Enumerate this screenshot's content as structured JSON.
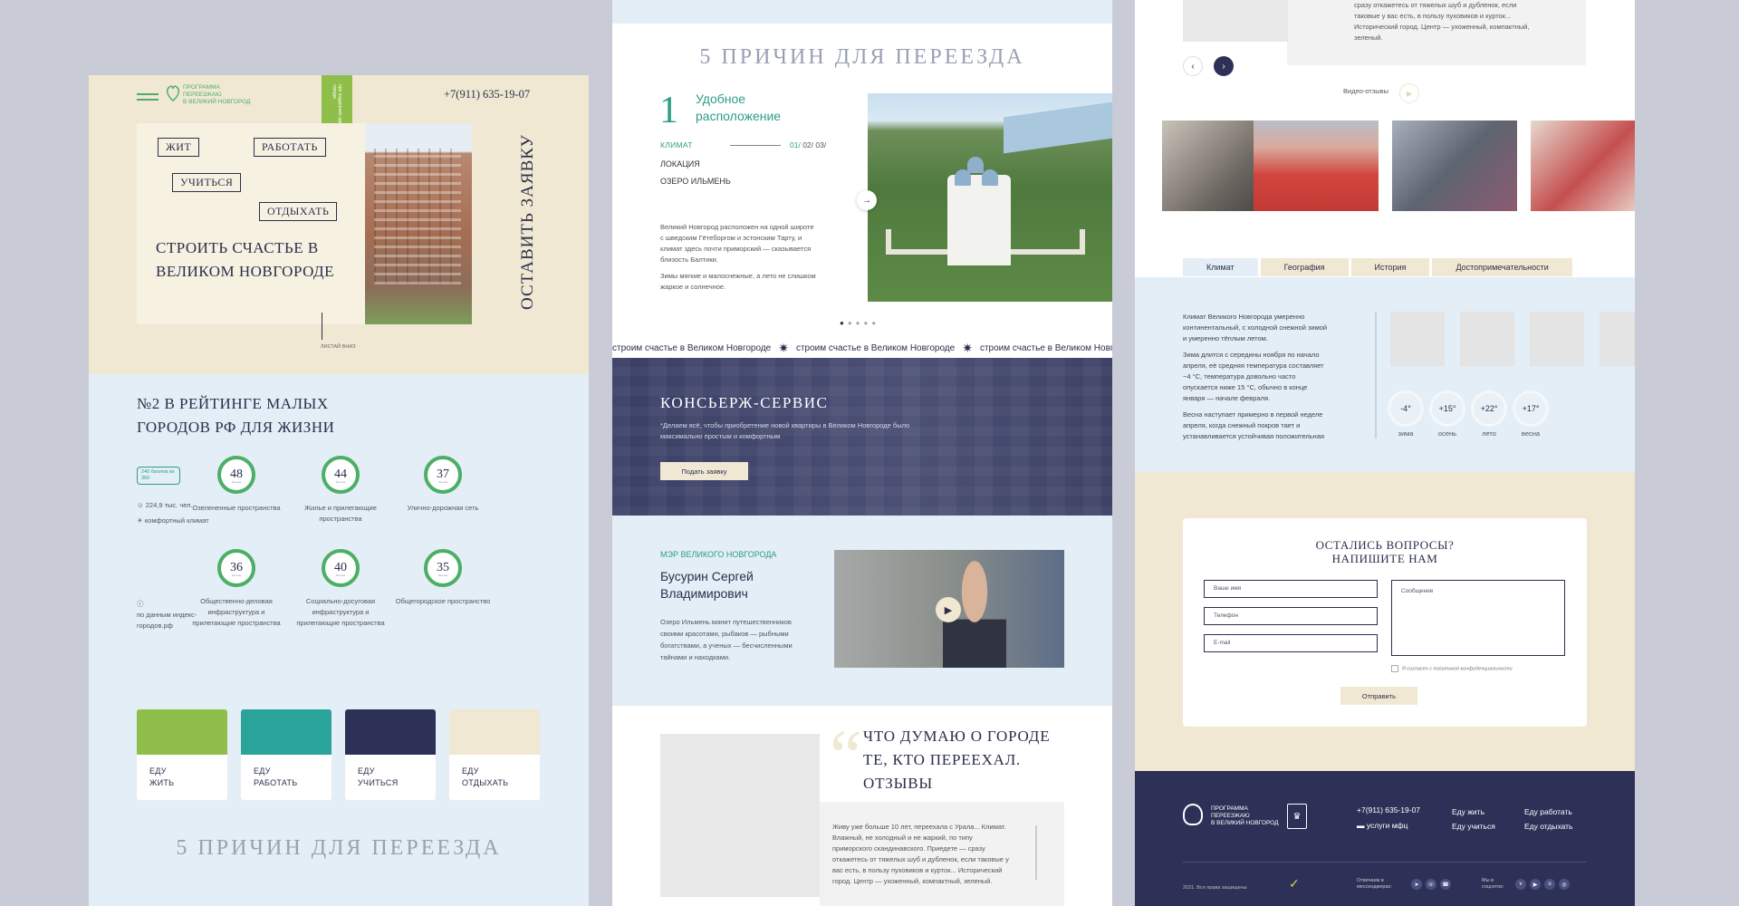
{
  "panel1": {
    "logo": {
      "line1": "ПРОГРАММА",
      "line2": "ПЕРЕЕЗЖАЮ",
      "line3": "В ВЕЛИКИЙ НОВГОРОД"
    },
    "phone": "+7(911) 635-19-07",
    "ribbon": "при поддержке администрации города",
    "tags": [
      "ЖИТ",
      "РАБОТАТЬ",
      "УЧИТЬСЯ",
      "ОТДЫХАТЬ"
    ],
    "hero_title": "СТРОИТЬ СЧАСТЬЕ В ВЕЛИКОМ НОВГОРОДЕ",
    "vertical_cta": "ОСТАВИТЬ ЗАЯВКУ",
    "scroll_label": "ЛИСТАЙ ВНИЗ",
    "rating_title": "№2 В РЕЙТИНГЕ МАЛЫХ ГОРОДОВ РФ ДЛЯ ЖИЗНИ",
    "badge": "240 баллов из 360",
    "stat_population": "224,9 тыс. чел.",
    "stat_climate": "комфортный климат",
    "source": "по данным индекс-городов.рф",
    "rings": [
      {
        "value": "48",
        "label": "Озелененные пространства"
      },
      {
        "value": "44",
        "label": "Жилье и прилегающие пространства"
      },
      {
        "value": "37",
        "label": "Улично-дорожная сеть"
      },
      {
        "value": "36",
        "label": "Общественно-деловая инфраструктура и прилегающие пространства"
      },
      {
        "value": "40",
        "label": "Социально-досуговая инфраструктура и прилегающие пространства"
      },
      {
        "value": "35",
        "label": "Общегородское пространство"
      }
    ],
    "ring_unit": "баллов",
    "cards": [
      {
        "line1": "ЕДУ",
        "line2": "ЖИТЬ",
        "color": "#8fbf4a"
      },
      {
        "line1": "ЕДУ",
        "line2": "РАБОТАТЬ",
        "color": "#2aa39b"
      },
      {
        "line1": "ЕДУ",
        "line2": "УЧИТЬСЯ",
        "color": "#2d3157"
      },
      {
        "line1": "ЕДУ",
        "line2": "ОТДЫХАТЬ",
        "color": "#f1e8d3"
      }
    ],
    "reasons_title": "5 ПРИЧИН ДЛЯ ПЕРЕЕЗДА"
  },
  "panel2": {
    "reasons_title": "5 ПРИЧИН ДЛЯ ПЕРЕЕЗДА",
    "reason_number": "1",
    "reason_heading1": "Удобное",
    "reason_heading2": "расположение",
    "klimat": "КЛИМАТ",
    "pages": {
      "current": "01/",
      "p2": "02/",
      "p3": "03/"
    },
    "items": [
      "ЛОКАЦИЯ",
      "ОЗЕРО ИЛЬМЕНЬ"
    ],
    "desc1": "Великий Новгород расположен на одной широте с шведским Гётеборгом и эстонским Тарту, и климат здесь почти приморский — сказывается близость Балтики.",
    "desc2": "Зимы мягкие и малоснежные, а лето не слишком жаркое и солнечное.",
    "marquee": "строим счастье в Великом Новгороде",
    "concierge_title": "КОНСЬЕРЖ-СЕРВИС",
    "concierge_text": "*Делаем всё, чтобы приобретение новой квартиры в Великом Новгороде было максимально простым и комфортным",
    "concierge_button": "Подать заявку",
    "mayor_role": "МЭР ВЕЛИКОГО НОВГОРОДА",
    "mayor_name1": "Бусурин Сергей",
    "mayor_name2": "Владимирович",
    "mayor_text": "Озеро Ильмень манит путешественников своими красотами, рыбаков — рыбными богатствами, а ученых — бесчисленными тайнами и находками.",
    "reviews_title": "ЧТО ДУМАЮ О ГОРОДЕ ТЕ, КТО ПЕРЕЕХАЛ. ОТЗЫВЫ",
    "review_text": "Живу уже больше 10 лет, переехала с Урала... Климат. Влажный, не холодный и не жаркий, по типу приморского скандинавского. Приедете — сразу откажетесь от тяжелых шуб и дубленок, если таковые у вас есть, в пользу пуховиков и курток... Исторический город. Центр — ухоженный, компактный, зеленый."
  },
  "panel3": {
    "top_text": "сразу откажетесь от тяжелых шуб и дубленок, если таковые у вас есть, в пользу пуховиков и курток... Исторический город. Центр — ухоженный, компактный, зеленый.",
    "video_label": "Видео-отзывы",
    "tabs": [
      "Климат",
      "География",
      "История",
      "Достопримечательности"
    ],
    "climate_p1": "Климат Великого Новгорода умеренно континентальный, с холодной снежной зимой и умеренно тёплым летом.",
    "climate_p2": "Зима длится с середины ноября по начало апреля, её средняя температура составляет −4 °C, температура довольно часто опускается ниже 15 °C, обычно в конце января — начале февраля.",
    "climate_p3": "Весна наступает примерно в первой неделе апреля, когда снежный покров тает и устанавливается устойчивая положительная",
    "temps": [
      {
        "value": "-4°",
        "label": "зима"
      },
      {
        "value": "+15°",
        "label": "осень"
      },
      {
        "value": "+22°",
        "label": "лето"
      },
      {
        "value": "+17°",
        "label": "весна"
      }
    ],
    "form_title1": "ОСТАЛИСЬ ВОПРОСЫ?",
    "form_title2": "НАПИШИТЕ НАМ",
    "placeholders": {
      "name": "Ваше имя",
      "phone": "Телефон",
      "email": "E-mail",
      "message": "Сообщение"
    },
    "agree": "Я согласен с политикой конфиденциальности",
    "send": "Отправить",
    "footer": {
      "logo1": "ПРОГРАММА",
      "logo2": "ПЕРЕЕЗЖАЮ",
      "logo3": "В ВЕЛИКИЙ НОВГОРОД",
      "phone": "+7(911) 635-19-07",
      "mfc": "услуги мфц",
      "links": [
        "Еду жить",
        "Еду работать",
        "Еду учиться",
        "Еду отдыхать"
      ],
      "copyright": "2021. Все права защищены",
      "messengers": "Отвечаем в мессенджерах:",
      "social": "Мы в соцсетях:"
    }
  }
}
